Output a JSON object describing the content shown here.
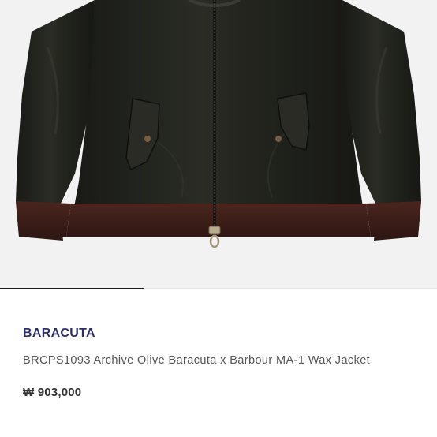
{
  "product": {
    "image_icon": "jacket-photo",
    "brand": "BARACUTA",
    "title": "BRCPS1093 Archive Olive Baracuta x Barbour MA-1 Wax Jacket",
    "price": "₩ 903,000"
  },
  "gallery": {
    "progress_fraction": 0.33
  },
  "colors": {
    "brand_text": "#2c2f66",
    "jacket_body": "#1f211c",
    "rib_trim": "#3e1f1a",
    "image_background": "#f2f2f2"
  }
}
